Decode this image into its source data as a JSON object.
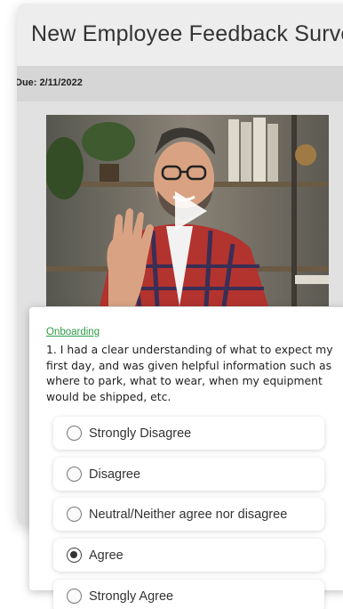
{
  "survey": {
    "title": "New Employee Feedback Survey",
    "due": "Due: 2/11/2022"
  },
  "video": {
    "subject": "man waving in front of bookshelf",
    "play_icon": "play-icon"
  },
  "question": {
    "category": "Onboarding",
    "text": "1. I had a clear understanding of what to expect my first day, and was given helpful information such as where to park, what to wear, when my equipment would be shipped, etc.",
    "options": [
      {
        "label": "Strongly Disagree",
        "selected": false
      },
      {
        "label": "Disagree",
        "selected": false
      },
      {
        "label": "Neutral/Neither agree nor disagree",
        "selected": false
      },
      {
        "label": "Agree",
        "selected": true
      },
      {
        "label": "Strongly Agree",
        "selected": false
      }
    ]
  },
  "colors": {
    "link_green": "#2e9a45",
    "card_gray": "#e4e4e4"
  }
}
